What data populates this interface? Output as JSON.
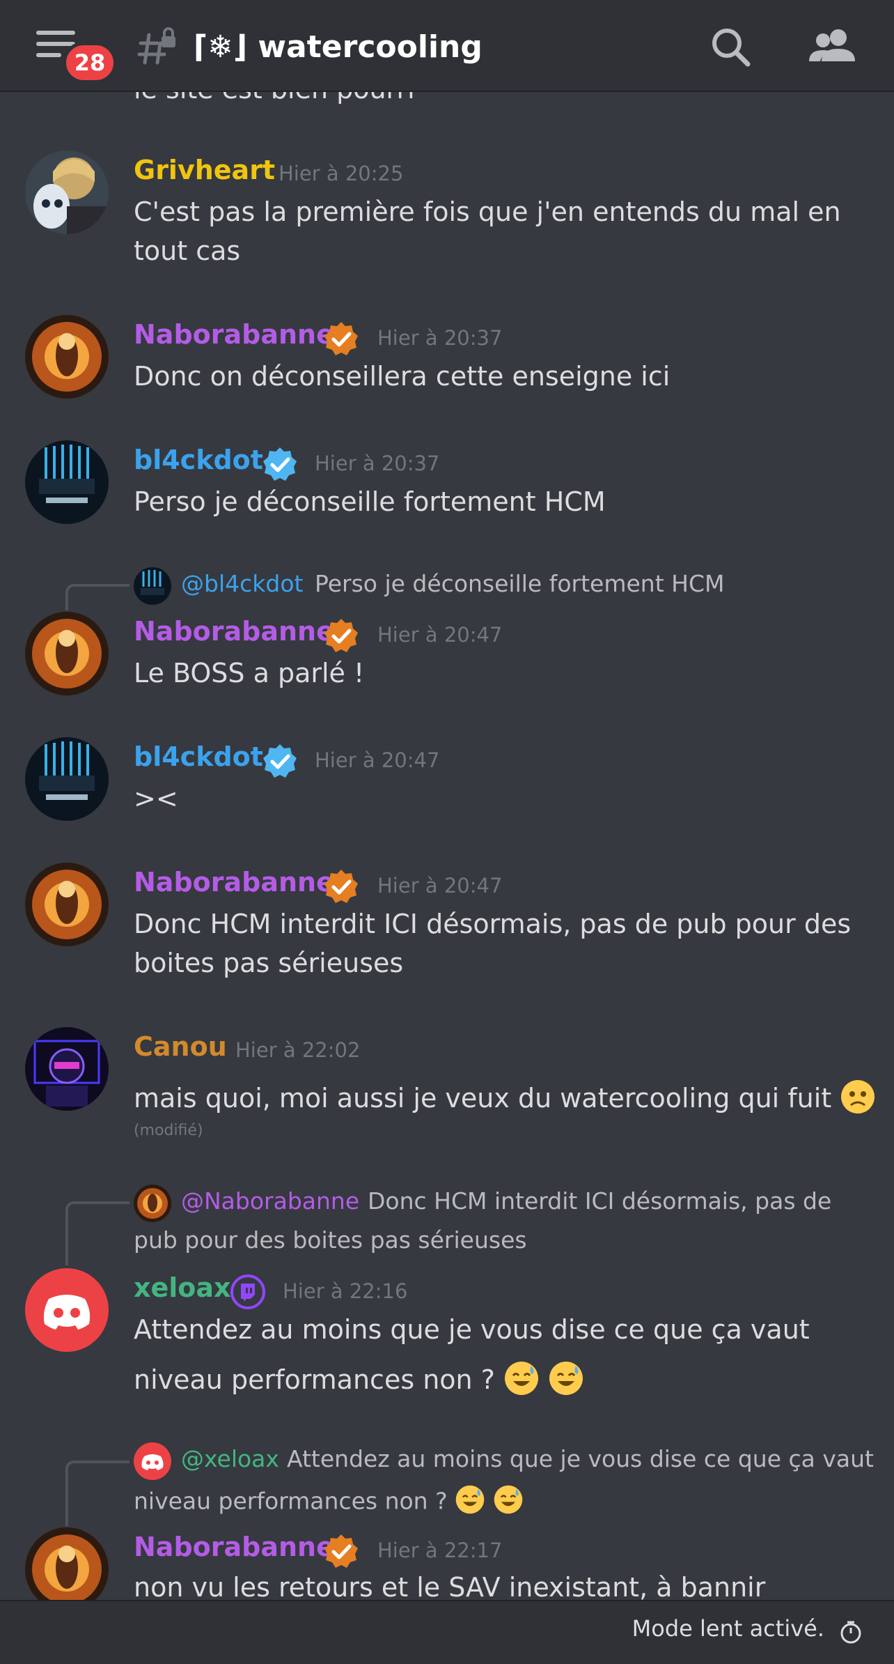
{
  "header": {
    "title": "⌈❄⌋ watercooling",
    "unread_badge": "28",
    "icons": [
      "menu-icon",
      "locked-channel-icon",
      "search-icon",
      "members-icon"
    ]
  },
  "colors": {
    "background": "#36393f",
    "header_bg": "#2f3136",
    "text": "#dcddde",
    "muted": "#72767d",
    "gold_user": "#f1c40f",
    "purple_user": "#b45ce6",
    "blue_user": "#3ba2ee",
    "orange_user": "#d4892d",
    "green_user": "#43b581",
    "badge_red": "#ed4245"
  },
  "messages": {
    "cut_top": "le site est bien pourri",
    "m1": {
      "author": "Grivheart",
      "time": "Hier à 20:25",
      "line1": "C'est pas la première fois que j'en entends du mal en",
      "line2": "tout cas"
    },
    "m2": {
      "author": "Naborabanne",
      "time": "Hier à 20:37",
      "line1": "Donc on déconseillera cette enseigne ici"
    },
    "m3": {
      "author": "bl4ckdot",
      "time": "Hier à 20:37",
      "line1": "Perso je déconseille fortement HCM"
    },
    "m4": {
      "reply_author": "@bl4ckdot",
      "reply_text": "Perso je déconseille fortement HCM",
      "author": "Naborabanne",
      "time": "Hier à 20:47",
      "line1": "Le BOSS a parlé !"
    },
    "m5": {
      "author": "bl4ckdot",
      "time": "Hier à 20:47",
      "line1": "><"
    },
    "m6": {
      "author": "Naborabanne",
      "time": "Hier à 20:47",
      "line1": "Donc HCM interdit ICI désormais, pas de pub pour des",
      "line2": "boites pas sérieuses"
    },
    "m7": {
      "author": "Canou",
      "time": "Hier à 22:02",
      "line1": "mais quoi, moi aussi je veux du watercooling qui fuit",
      "edited": "(modifié)"
    },
    "m8": {
      "reply_author": "@Naborabanne",
      "reply_text": "Donc HCM interdit ICI désormais, pas de",
      "reply_text2": "pub pour des boites pas sérieuses",
      "author": "xeloax",
      "time": "Hier à 22:16",
      "line1": "Attendez au moins que je vous dise ce que ça vaut",
      "line2": "niveau performances non ?"
    },
    "m9": {
      "reply_author": "@xeloax",
      "reply_text": "Attendez au moins que je vous dise ce que ça vaut",
      "reply_text2": "niveau performances non ?",
      "author": "Naborabanne",
      "time": "Hier à 22:17",
      "line1": "non vu les retours et le SAV inexistant, à bannir"
    }
  },
  "footer": {
    "slowmode": "Mode lent activé."
  }
}
